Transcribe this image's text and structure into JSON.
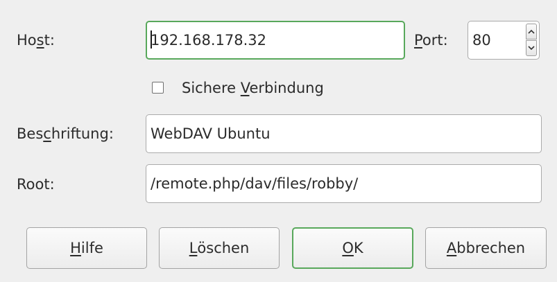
{
  "host": {
    "label_pre": "Ho",
    "label_accel": "s",
    "label_post": "t:",
    "value": "192.168.178.32"
  },
  "port": {
    "label_accel": "P",
    "label_post": "ort:",
    "value": "80",
    "up_icon": "chevron-up-icon",
    "down_icon": "chevron-down-icon"
  },
  "secure": {
    "label_pre": "Sichere ",
    "label_accel": "V",
    "label_post": "erbindung",
    "checked": false
  },
  "caption": {
    "label_pre": "Bes",
    "label_accel": "c",
    "label_post": "hriftung:",
    "value": "WebDAV Ubuntu"
  },
  "root": {
    "label": "Root:",
    "value": "/remote.php/dav/files/robby/"
  },
  "buttons": {
    "help": {
      "accel": "H",
      "rest": "ilfe"
    },
    "delete": {
      "accel": "L",
      "rest": "öschen"
    },
    "ok": {
      "accel": "O",
      "rest": "K"
    },
    "cancel": {
      "accel": "A",
      "rest": "bbrechen"
    }
  },
  "colors": {
    "focus_accent": "#58a85b",
    "background": "#efefef"
  }
}
